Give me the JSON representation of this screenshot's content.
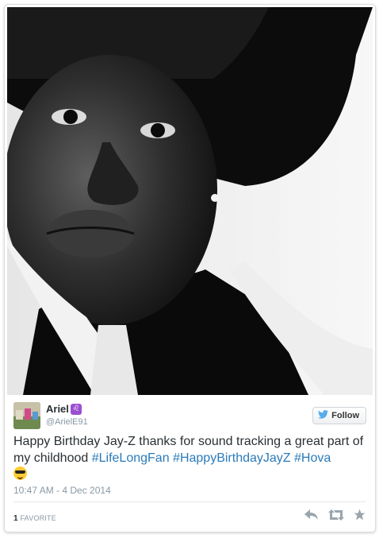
{
  "user": {
    "name": "Ariel",
    "badge_glyph": "♌",
    "handle": "@ArielE91"
  },
  "follow_button": {
    "label": "Follow"
  },
  "tweet": {
    "text": "Happy Birthday Jay-Z thanks for sound tracking a great part of my childhood",
    "hashtags": [
      "#LifeLongFan",
      "#HappyBirthdayJayZ",
      "#Hova"
    ],
    "emoji": "smiling-face-with-sunglasses",
    "timestamp": "10:47 AM - 4 Dec 2014"
  },
  "stats": {
    "favorites_count": "1",
    "favorites_label": "FAVORITE"
  },
  "icons": {
    "reply": "reply-icon",
    "retweet": "retweet-icon",
    "favorite": "star-icon",
    "follow": "bird-icon"
  },
  "colors": {
    "link": "#2b7bb9",
    "muted": "#8899a6",
    "text": "#292f33",
    "twitter_blue": "#55acee"
  }
}
